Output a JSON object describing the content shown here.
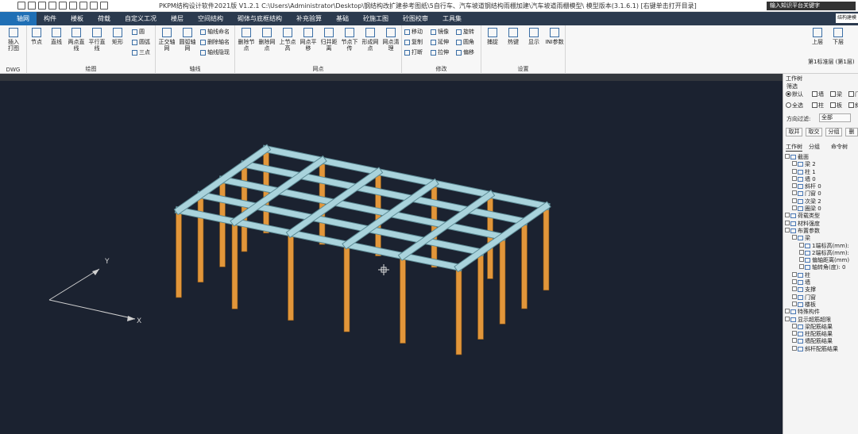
{
  "titlebar": {
    "title": "PKPM结构设计软件2021版 V1.2.1 C:\\Users\\Administrator\\Desktop\\钢结构改扩建参考图纸\\5自行车、汽车坡道钢结构雨棚加建\\汽车坡道雨棚模型\\  模型版本(3.1.6.1)  [右键单击打开目录]",
    "search_placeholder": "输入知识平台关键字"
  },
  "menu": {
    "tabs": [
      "轴网",
      "构件",
      "楼板",
      "荷载",
      "自定义工况",
      "楼层",
      "空间结构",
      "砌体与底框结构",
      "补充验算",
      "基础",
      "砼施工图",
      "砼图校审",
      "工具集"
    ],
    "active": "轴网",
    "right_input": "结构建模"
  },
  "ribbon": {
    "print_label1": "插入",
    "print_label2": "打图",
    "dwg": "DWG",
    "groups": {
      "draw": "绘图",
      "axis": "轴线",
      "node": "网点",
      "modify": "修改",
      "settings": "设置"
    },
    "draw_buttons": [
      "节点",
      "直线",
      "两点直线",
      "平行直线",
      "矩形"
    ],
    "draw_small": [
      "圆",
      "圆弧",
      "三点"
    ],
    "axis_buttons": [
      "正交轴网",
      "圆弧轴网"
    ],
    "axis_small": [
      "轴线命名",
      "删除轴名",
      "轴线隐现"
    ],
    "node_buttons": [
      "删除节点",
      "删除网点",
      "上节点高",
      "网点平移",
      "归并距离",
      "节点下传",
      "形成网点",
      "网点清理"
    ],
    "modify_small": [
      "移动",
      "镜像",
      "旋转",
      "复制",
      "延伸",
      "圆角",
      "打断",
      "拉伸",
      "偏移"
    ],
    "settings_buttons": [
      "捕捉",
      "热键",
      "显示",
      "INI参数"
    ],
    "floor": {
      "up": "上层",
      "down": "下层",
      "current": "第1标准层 (第1层)"
    }
  },
  "viewport": {
    "axis_y": "Y",
    "axis_x": "X",
    "beam_color": "#a9d3dc",
    "column_color": "#e2963a"
  },
  "right_panel": {
    "title": "工作树",
    "filter_label": "筛选",
    "radio_default": "默认",
    "radio_all": "全选",
    "checks": [
      "墙",
      "梁",
      "门",
      "柱",
      "板",
      "斜"
    ],
    "direction_label": "方向过滤:",
    "direction_value": "全部",
    "buttons": [
      "取并",
      "取交",
      "分组",
      "删"
    ],
    "tabs": [
      "工作树",
      "分组",
      "命令树"
    ],
    "tree": [
      {
        "indent": 0,
        "label": "截面"
      },
      {
        "indent": 1,
        "label": "梁 2"
      },
      {
        "indent": 1,
        "label": "柱 1"
      },
      {
        "indent": 1,
        "label": "墙 0"
      },
      {
        "indent": 1,
        "label": "斜杆 0"
      },
      {
        "indent": 1,
        "label": "门窗 0"
      },
      {
        "indent": 1,
        "label": "次梁 2"
      },
      {
        "indent": 1,
        "label": "圈梁 0"
      },
      {
        "indent": 0,
        "label": "荷载类型"
      },
      {
        "indent": 0,
        "label": "材料强度"
      },
      {
        "indent": 0,
        "label": "布置参数"
      },
      {
        "indent": 1,
        "label": "梁"
      },
      {
        "indent": 2,
        "label": "1端标高(mm):"
      },
      {
        "indent": 2,
        "label": "2端标高(mm):"
      },
      {
        "indent": 2,
        "label": "偏轴距离(mm)"
      },
      {
        "indent": 2,
        "label": "轴转角(度): 0"
      },
      {
        "indent": 1,
        "label": "柱"
      },
      {
        "indent": 1,
        "label": "墙"
      },
      {
        "indent": 1,
        "label": "支撑"
      },
      {
        "indent": 1,
        "label": "门窗"
      },
      {
        "indent": 1,
        "label": "楼板"
      },
      {
        "indent": 0,
        "label": "特殊构件"
      },
      {
        "indent": 0,
        "label": "显示超筋超限"
      },
      {
        "indent": 1,
        "label": "梁配筋结果"
      },
      {
        "indent": 1,
        "label": "柱配筋结果"
      },
      {
        "indent": 1,
        "label": "墙配筋结果"
      },
      {
        "indent": 1,
        "label": "斜杆配筋结果"
      }
    ]
  }
}
